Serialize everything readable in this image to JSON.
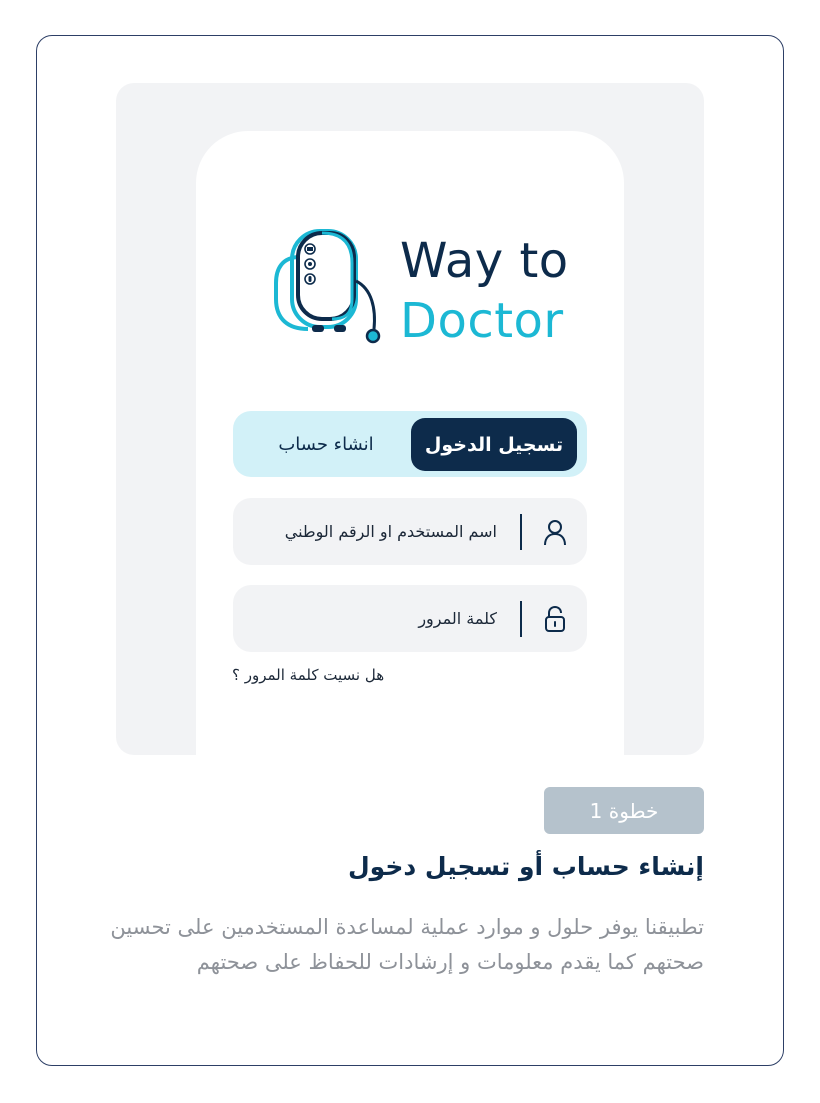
{
  "app": {
    "logo_line1": "Way to",
    "logo_line2": "Doctor"
  },
  "tabs": {
    "login_label": "تسجيل الدخول",
    "register_label": "انشاء حساب",
    "active": "login"
  },
  "form": {
    "username_placeholder": "اسم المستخدم او الرقم الوطني",
    "password_placeholder": "كلمة المرور",
    "forgot_password": "هل نسيت كلمة المرور ؟"
  },
  "step": {
    "badge": "خطوة 1",
    "title": "إنشاء حساب أو تسجيل دخول",
    "description": "تطبيقنا يوفر حلول و موارد عملية لمساعدة المستخدمين على تحسين صحتهم كما يقدم معلومات و إرشادات للحفاظ على صحتهم"
  },
  "colors": {
    "navy": "#0d2b4b",
    "cyan": "#1cb8d4",
    "tab_bg": "#d2f1f8",
    "badge": "#b5c2cc",
    "card_border": "#2d3f66"
  },
  "icons": {
    "user_field": "user-icon",
    "password_field": "unlock-icon",
    "logo": "phone-stethoscope-logo"
  }
}
